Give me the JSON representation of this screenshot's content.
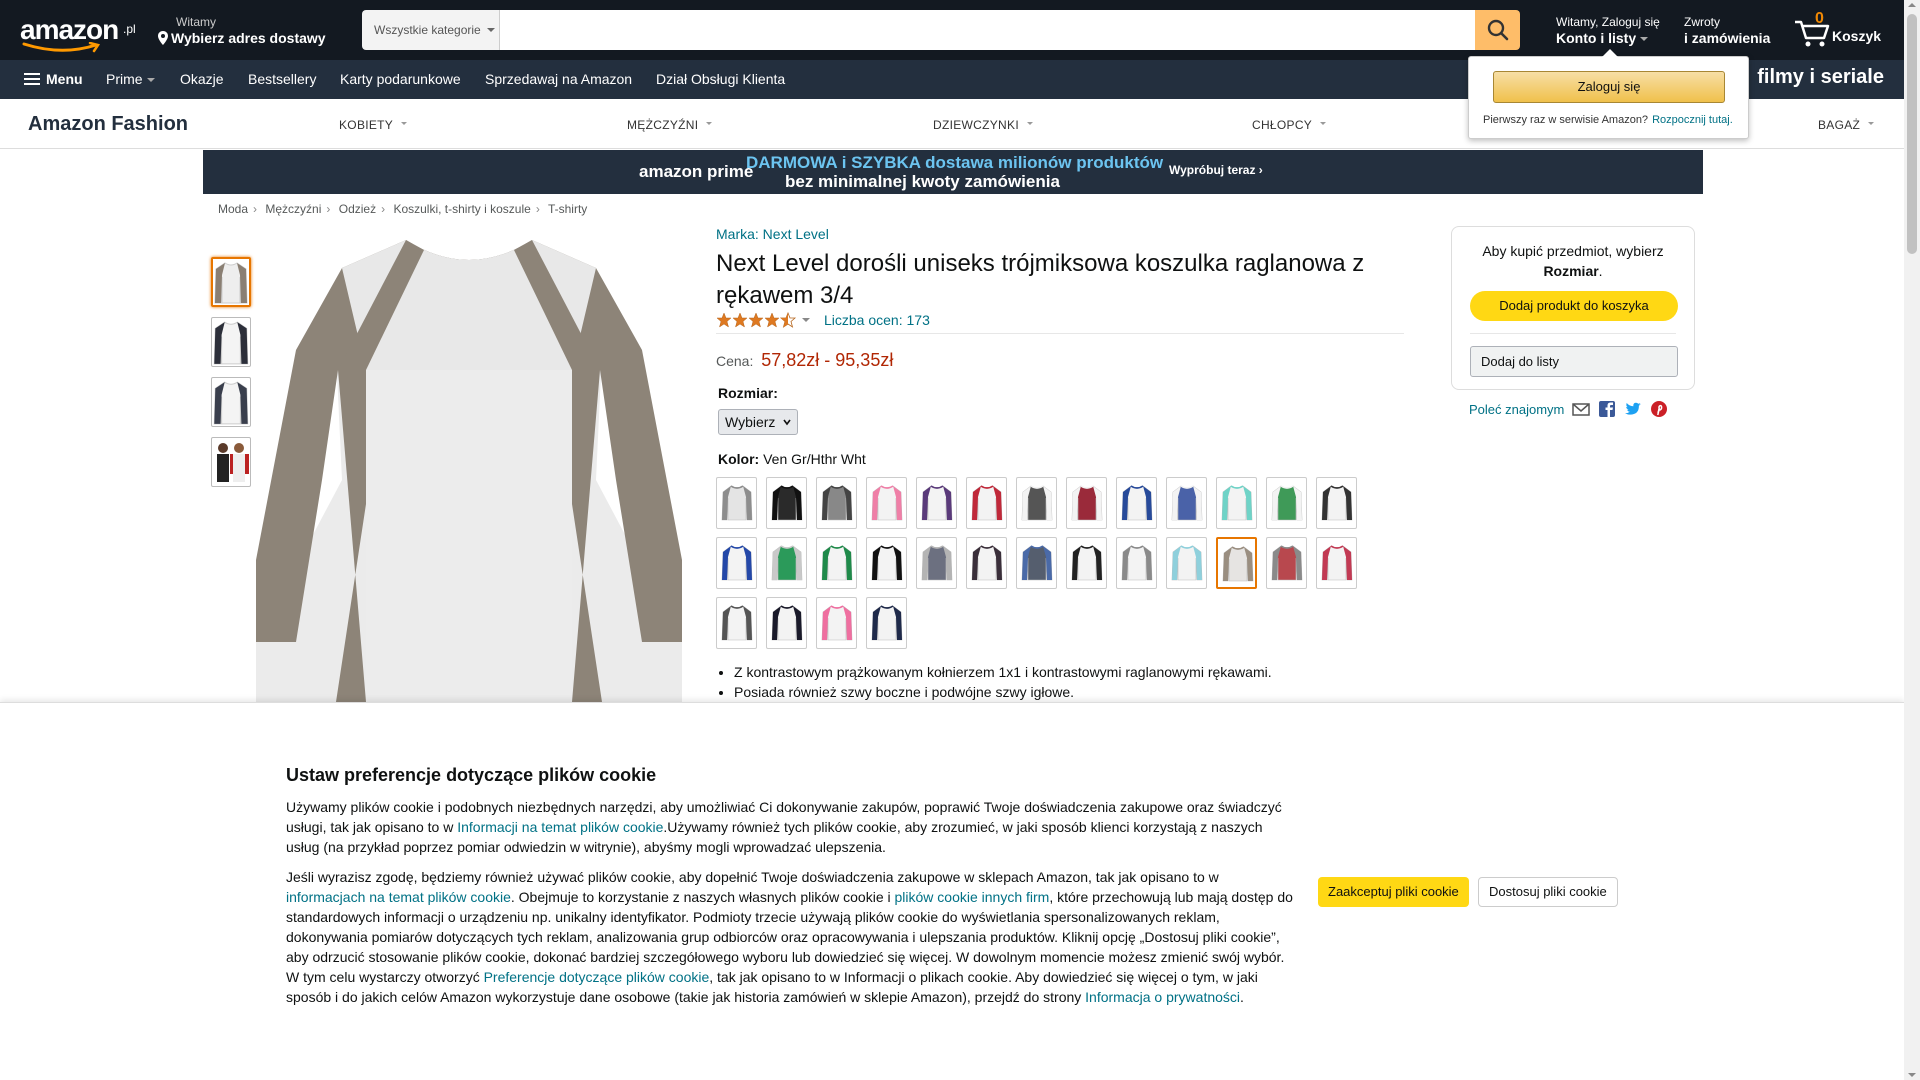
{
  "header": {
    "logo_tld": ".pl",
    "deliver_line1": "Witamy",
    "deliver_line2": "Wybierz adres dostawy",
    "search_category": "Wszystkie kategorie",
    "search_placeholder": "",
    "account_line1": "Witamy, Zaloguj się",
    "account_line2": "Konto i listy",
    "returns_line1": "Zwroty",
    "returns_line2": "i zamówienia",
    "cart_count": "0",
    "cart_label": "Koszyk"
  },
  "subnav": {
    "menu": "Menu",
    "items": [
      "Prime",
      "Okazje",
      "Bestsellery",
      "Karty podarunkowe",
      "Sprzedawaj na Amazon",
      "Dział Obsługi Klienta"
    ],
    "promo": "filmy i seriale"
  },
  "fashion": {
    "logo": "Amazon Fashion",
    "categories": [
      "KOBIETY",
      "MĘŻCZYŹNI",
      "DZIEWCZYNKI",
      "CHŁOPCY",
      "BAGAŻ"
    ]
  },
  "prime_banner": {
    "logo": "amazon prime",
    "line1": "DARMOWA i SZYBKA dostawa milionów produktów",
    "line2": "bez minimalnej kwoty zamówienia",
    "cta": "Wypróbuj teraz ›"
  },
  "breadcrumb": [
    "Moda",
    "Mężczyźni",
    "Odzież",
    "Koszulki, t-shirty i koszule",
    "T-shirty"
  ],
  "product": {
    "brand": "Marka: Next Level",
    "title": "Next Level dorośli uniseks trójmiksowa koszulka raglanowa z rękawem 3/4",
    "rating": 4.5,
    "rating_count": "Liczba ocen: 173",
    "price_label": "Cena:",
    "price": "57,82zł - 95,35zł",
    "size_label": "Rozmiar:",
    "size_value": "Wybierz",
    "color_label": "Kolor:",
    "color_value": "Ven Gr/Hthr Wht",
    "bullets": [
      "Z kontrastowym prążkowanym kołnierzem 1x1 i kontrastowymi raglanowymi rękawami.",
      "Posiada również szwy boczne i podwójne szwy igłowe."
    ],
    "swatches": [
      {
        "body": "#e4e4e4",
        "sleeve": "#8d8d8d"
      },
      {
        "body": "#2a2a2a",
        "sleeve": "#111111"
      },
      {
        "body": "#888888",
        "sleeve": "#444444"
      },
      {
        "body": "#f3f3f3",
        "sleeve": "#ef7fa7"
      },
      {
        "body": "#f3f3f3",
        "sleeve": "#5a3a7a"
      },
      {
        "body": "#f3f3f3",
        "sleeve": "#c0293a"
      },
      {
        "body": "#555555",
        "sleeve": "#f3f3f3"
      },
      {
        "body": "#9a2a3a",
        "sleeve": "#f3f3f3"
      },
      {
        "body": "#f3f3f3",
        "sleeve": "#274a9a"
      },
      {
        "body": "#4a62a8",
        "sleeve": "#f3f3f3"
      },
      {
        "body": "#f3f3f3",
        "sleeve": "#6fd3c7"
      },
      {
        "body": "#3f9a58",
        "sleeve": "#f3f3f3"
      },
      {
        "body": "#f3f3f3",
        "sleeve": "#333333"
      },
      {
        "body": "#f3f3f3",
        "sleeve": "#2448a8"
      },
      {
        "body": "#2b9a5a",
        "sleeve": "#c9c9c9"
      },
      {
        "body": "#f3f3f3",
        "sleeve": "#1f8a4a"
      },
      {
        "body": "#f3f3f3",
        "sleeve": "#111111"
      },
      {
        "body": "#6c7080",
        "sleeve": "#b4b4b4"
      },
      {
        "body": "#f3f3f3",
        "sleeve": "#3a2f3a"
      },
      {
        "body": "#555e6e",
        "sleeve": "#4a6aa8"
      },
      {
        "body": "#f3f3f3",
        "sleeve": "#222222"
      },
      {
        "body": "#f3f3f3",
        "sleeve": "#8a8a8a"
      },
      {
        "body": "#f3f3f3",
        "sleeve": "#8fd0dc"
      },
      {
        "body": "#e6e4e2",
        "sleeve": "#9a8e80"
      },
      {
        "body": "#b8484e",
        "sleeve": "#8a8a8a"
      },
      {
        "body": "#f3f3f3",
        "sleeve": "#c23a54"
      },
      {
        "body": "#f3f3f3",
        "sleeve": "#555555"
      },
      {
        "body": "#f3f3f3",
        "sleeve": "#1a1a2a"
      },
      {
        "body": "#f3f3f3",
        "sleeve": "#ef6fa0"
      },
      {
        "body": "#f3f3f3",
        "sleeve": "#1f2a4a"
      }
    ],
    "selected_swatch": 23
  },
  "buybox": {
    "message_prefix": "Aby kupić przedmiot, wybierz",
    "message_bold": "Rozmiar",
    "add_to_cart": "Dodaj produkt do koszyka",
    "add_to_list": "Dodaj do listy",
    "share": "Poleć znajomym"
  },
  "signin_popup": {
    "button": "Zaloguj się",
    "new_customer": "Pierwszy raz w serwisie Amazon?",
    "start_link": "Rozpocznij tutaj."
  },
  "cookie": {
    "heading": "Ustaw preferencje dotyczące plików cookie",
    "p1_a": "Używamy plików cookie i podobnych niezbędnych narzędzi, aby umożliwiać Ci dokonywanie zakupów, poprawić Twoje doświadczenia zakupowe oraz świadczyć usługi, tak jak opisano to w ",
    "p1_link": "Informacji na temat plików cookie",
    "p1_b": ".Używamy również tych plików cookie, aby zrozumieć, w jaki sposób klienci korzystają z naszych usług (na przykład poprzez pomiar odwiedzin w witrynie), abyśmy mogli wprowadzać ulepszenia.",
    "p2_a": "Jeśli wyrazisz zgodę, będziemy również używać plików cookie, aby dopełnić Twoje doświadczenia zakupowe w sklepach Amazon, tak jak opisano to w ",
    "p2_link1": "informacjach na temat plików cookie",
    "p2_b": ". Obejmuje to korzystanie z naszych własnych plików cookie i ",
    "p2_link2": "plików cookie innych firm",
    "p2_c": ", które przechowują lub mają dostęp do standardowych informacji o urządzeniu np. unikalny identyfikator. Podmioty trzecie używają plików cookie do wyświetlania spersonalizowanych reklam, dokonywania pomiarów dotyczących tych reklam, analizowania grup odbiorców oraz opracowywania i ulepszania produktów. Kliknij opcję „Dostosuj pliki cookie”, aby odrzucić stosowanie plików cookie, dokonać bardziej szczegółowego wyboru lub dowiedzieć się więcej. W dowolnym momencie możesz zmienić swój wybór. W tym celu wystarczy otworzyć ",
    "p2_link3": "Preferencje dotyczące plików cookie",
    "p2_d": ", tak jak opisano to w Informacji o plikach cookie. Aby dowiedzieć się więcej o tym, w jaki sposób i do jakich celów Amazon wykorzystuje dane osobowe (takie jak historia zamówień w sklepie Amazon), przejdź do strony ",
    "p2_link4": "Informacja o prywatności",
    "p2_e": ".",
    "accept": "Zaakceptuj pliki cookie",
    "customize": "Dostosuj pliki cookie"
  }
}
